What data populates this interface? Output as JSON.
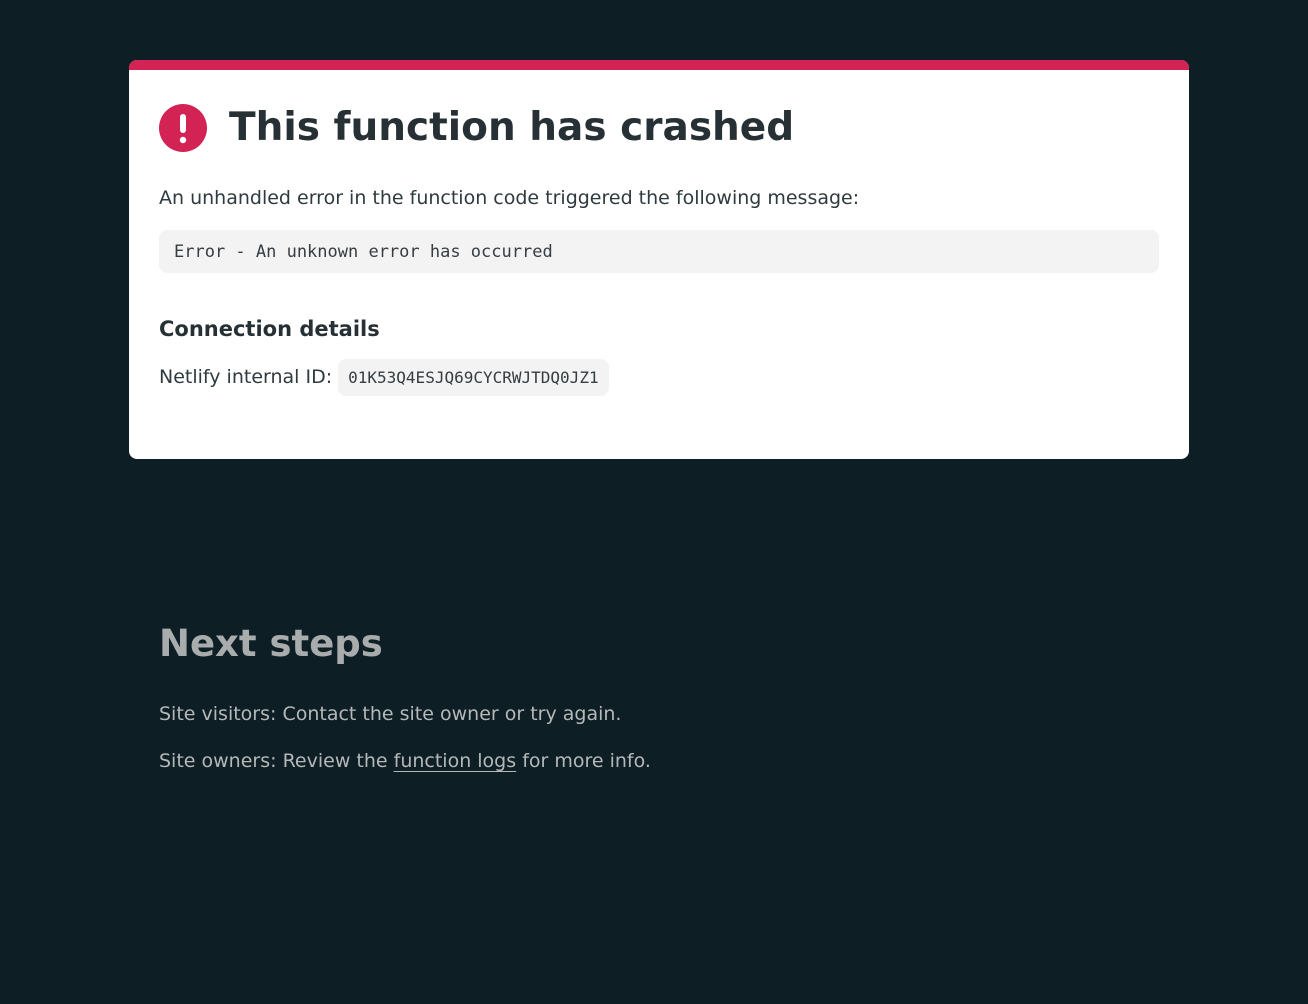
{
  "colors": {
    "background": "#0e1e25",
    "card": "#ffffff",
    "accent": "#d32254",
    "code_bg": "#f3f3f4"
  },
  "card": {
    "icon": "alert-circle-icon",
    "title": "This function has crashed",
    "intro": "An unhandled error in the function code triggered the following message:",
    "error_message": "Error - An unknown error has occurred",
    "connection_heading": "Connection details",
    "id_label": "Netlify internal ID:",
    "id_value": "01K53Q4ESJQ69CYCRWJTDQ0JZ1"
  },
  "next_steps": {
    "heading": "Next steps",
    "visitors_text": "Site visitors: Contact the site owner or try again.",
    "owners_prefix": "Site owners: Review the ",
    "owners_link": "function logs",
    "owners_suffix": " for more info."
  }
}
